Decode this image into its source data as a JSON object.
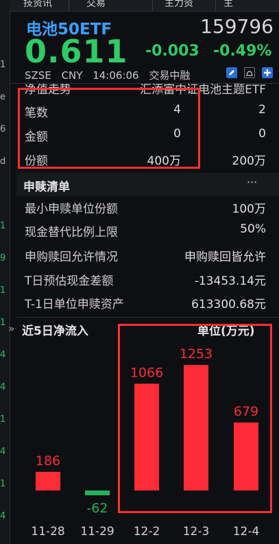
{
  "top_tabs": [
    "技资讯",
    "交易",
    "主力资",
    "主"
  ],
  "left_strip": [
    "",
    "1",
    "e",
    "6",
    "d",
    "",
    "1",
    "9",
    "1",
    "1",
    "4",
    "4",
    "1",
    "4",
    "1",
    "4"
  ],
  "stock": {
    "name": "电池50ETF",
    "code": "159796",
    "price": "0.611",
    "change": "-0.003",
    "change_pct": "-0.49%",
    "exchange": "SZSE",
    "currency": "CNY",
    "time": "14:06:06",
    "status": "交易中融"
  },
  "nav_table": {
    "header_left": "净值走势",
    "header_right": "汇添富中证电池主题ETF",
    "rows": [
      {
        "label": "笔数",
        "c1": "4",
        "c2": "2"
      },
      {
        "label": "金额",
        "c1": "0",
        "c2": "0"
      },
      {
        "label": "份额",
        "c1": "400万",
        "c2": "200万"
      }
    ]
  },
  "subscription": {
    "title": "申赎清单",
    "more": "···",
    "items": [
      {
        "k": "最小申赎单位份额",
        "v": "100万"
      },
      {
        "k": "现金替代比例上限",
        "v": "50%"
      },
      {
        "k": "申购赎回允许情况",
        "v": "申购赎回皆允许"
      },
      {
        "k": "T日预估现金差额",
        "v": "-13453.14元"
      },
      {
        "k": "T-1日单位申赎资产",
        "v": "613300.68元"
      }
    ]
  },
  "chart": {
    "expand_glyph": "»",
    "title": "近5日净流入",
    "unit": "单位(万元)"
  },
  "colors": {
    "positive": "#ff2b36",
    "negative": "#1fb45a",
    "accent": "#3aa0ff",
    "highlight_box": "#ff3030"
  },
  "chart_data": {
    "type": "bar",
    "title": "近5日净流入",
    "unit": "万元",
    "categories": [
      "11-28",
      "11-29",
      "12-2",
      "12-3",
      "12-4"
    ],
    "values": [
      186,
      -62,
      1066,
      1253,
      679
    ],
    "ylim": [
      -62,
      1253
    ],
    "grid": false,
    "legend": "none"
  }
}
